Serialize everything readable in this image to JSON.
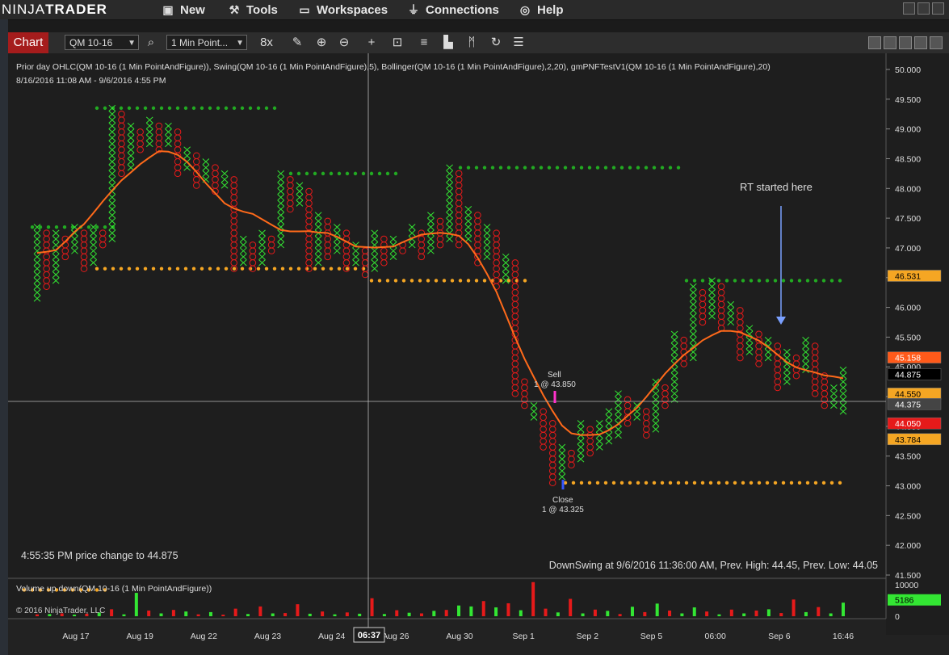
{
  "app": {
    "logo_light": "NINJA",
    "logo_bold": "TRADER",
    "menu": [
      {
        "label": "New",
        "icon": "new-icon"
      },
      {
        "label": "Tools",
        "icon": "tools-icon"
      },
      {
        "label": "Workspaces",
        "icon": "workspaces-icon"
      },
      {
        "label": "Connections",
        "icon": "connections-icon"
      },
      {
        "label": "Help",
        "icon": "help-icon"
      }
    ]
  },
  "toolbar": {
    "tab_label": "Chart",
    "instrument": "QM 10-16",
    "interval": "1 Min Point...",
    "tools": [
      "search-icon",
      "bar-type-icon",
      "draw-icon",
      "zoom-in-icon",
      "zoom-out-icon",
      "crosshair-icon",
      "data-box-icon",
      "indicators-icon",
      "strategies-icon",
      "properties-icon",
      "reload-icon",
      "list-icon"
    ]
  },
  "chart": {
    "header_line1": "Prior day OHLC(QM 10-16 (1 Min PointAndFigure)), Swing(QM 10-16 (1 Min PointAndFigure),5), Bollinger(QM 10-16 (1 Min PointAndFigure),2,20), gmPNFTestV1(QM 10-16 (1 Min PointAndFigure),20)",
    "header_line2": "8/16/2016 11:08 AM - 9/6/2016 4:55 PM",
    "annotation_rt": "RT started here",
    "sell_label": "Sell",
    "sell_detail": "1 @ 43.850",
    "close_label": "Close",
    "close_detail": "1 @ 43.325",
    "status_left": "4:55:35 PM price change to 44.875",
    "status_right": "DownSwing at 9/6/2016 11:36:00 AM, Prev. High: 44.45, Prev. Low: 44.05",
    "volume_header": "Volume up down(QM 10-16 (1 Min PointAndFigure))",
    "copyright": "© 2016 NinjaTrader, LLC",
    "crosshair_time": "06:37",
    "colors": {
      "up": "#33e633",
      "down": "#e61a1a",
      "bollinger": "#f0a030",
      "swing": "#ff6a1a"
    }
  },
  "chart_data": {
    "type": "point-and-figure",
    "y_axis": {
      "min": 41.5,
      "max": 50.0,
      "ticks": [
        "50.000",
        "49.500",
        "49.000",
        "48.500",
        "48.000",
        "47.500",
        "47.000",
        "46.500",
        "46.000",
        "45.500",
        "45.000",
        "44.500",
        "44.000",
        "43.500",
        "43.000",
        "42.500",
        "42.000",
        "41.500"
      ]
    },
    "x_axis": {
      "labels": [
        "Aug 17",
        "Aug 19",
        "Aug 22",
        "Aug 23",
        "Aug 24",
        "Aug 26",
        "Aug 30",
        "Sep 1",
        "Sep 2",
        "Sep 5",
        "06:00",
        "Sep 6",
        "16:46"
      ]
    },
    "price_markers": [
      {
        "label": "46.531",
        "value": 46.531,
        "color": "#f5a623",
        "text_color": "#000"
      },
      {
        "label": "45.158",
        "value": 45.158,
        "color": "#ff5a1a",
        "text_color": "#fff"
      },
      {
        "label": "44.875",
        "value": 44.875,
        "color": "#000000",
        "text_color": "#fff"
      },
      {
        "label": "44.550",
        "value": 44.55,
        "color": "#f5a623",
        "text_color": "#000"
      },
      {
        "label": "44.375",
        "value": 44.375,
        "color": "#444444",
        "text_color": "#fff"
      },
      {
        "label": "44.050",
        "value": 44.05,
        "color": "#e61a1a",
        "text_color": "#fff"
      },
      {
        "label": "43.784",
        "value": 43.784,
        "color": "#f5a623",
        "text_color": "#000"
      }
    ],
    "columns": [
      {
        "t": "X",
        "lo": 46.15,
        "hi": 47.35
      },
      {
        "t": "O",
        "lo": 46.35,
        "hi": 47.25
      },
      {
        "t": "X",
        "lo": 46.45,
        "hi": 47.25
      },
      {
        "t": "O",
        "lo": 46.85,
        "hi": 47.15
      },
      {
        "t": "X",
        "lo": 46.95,
        "hi": 47.35
      },
      {
        "t": "O",
        "lo": 46.65,
        "hi": 47.25
      },
      {
        "t": "X",
        "lo": 46.75,
        "hi": 47.35
      },
      {
        "t": "O",
        "lo": 47.05,
        "hi": 47.25
      },
      {
        "t": "X",
        "lo": 47.15,
        "hi": 49.35
      },
      {
        "t": "O",
        "lo": 48.25,
        "hi": 49.25
      },
      {
        "t": "X",
        "lo": 48.35,
        "hi": 49.05
      },
      {
        "t": "O",
        "lo": 48.65,
        "hi": 48.95
      },
      {
        "t": "X",
        "lo": 48.75,
        "hi": 49.15
      },
      {
        "t": "O",
        "lo": 48.65,
        "hi": 49.05
      },
      {
        "t": "X",
        "lo": 48.75,
        "hi": 49.05
      },
      {
        "t": "O",
        "lo": 48.25,
        "hi": 48.95
      },
      {
        "t": "X",
        "lo": 48.35,
        "hi": 48.65
      },
      {
        "t": "O",
        "lo": 48.05,
        "hi": 48.55
      },
      {
        "t": "X",
        "lo": 48.15,
        "hi": 48.45
      },
      {
        "t": "O",
        "lo": 47.95,
        "hi": 48.35
      },
      {
        "t": "X",
        "lo": 48.05,
        "hi": 48.25
      },
      {
        "t": "O",
        "lo": 46.65,
        "hi": 48.15
      },
      {
        "t": "X",
        "lo": 46.75,
        "hi": 47.15
      },
      {
        "t": "O",
        "lo": 46.65,
        "hi": 47.05
      },
      {
        "t": "X",
        "lo": 46.75,
        "hi": 47.25
      },
      {
        "t": "O",
        "lo": 46.95,
        "hi": 47.15
      },
      {
        "t": "X",
        "lo": 47.05,
        "hi": 48.25
      },
      {
        "t": "O",
        "lo": 47.65,
        "hi": 48.15
      },
      {
        "t": "X",
        "lo": 47.75,
        "hi": 48.05
      },
      {
        "t": "O",
        "lo": 46.65,
        "hi": 47.95
      },
      {
        "t": "X",
        "lo": 46.75,
        "hi": 47.55
      },
      {
        "t": "O",
        "lo": 46.85,
        "hi": 47.45
      },
      {
        "t": "X",
        "lo": 46.95,
        "hi": 47.35
      },
      {
        "t": "O",
        "lo": 46.65,
        "hi": 47.25
      },
      {
        "t": "X",
        "lo": 46.75,
        "hi": 47.05
      },
      {
        "t": "O",
        "lo": 46.55,
        "hi": 46.95
      },
      {
        "t": "X",
        "lo": 46.65,
        "hi": 47.25
      },
      {
        "t": "O",
        "lo": 46.75,
        "hi": 47.15
      },
      {
        "t": "X",
        "lo": 46.85,
        "hi": 47.15
      },
      {
        "t": "O",
        "lo": 46.95,
        "hi": 47.05
      },
      {
        "t": "X",
        "lo": 47.05,
        "hi": 47.35
      },
      {
        "t": "O",
        "lo": 46.85,
        "hi": 47.25
      },
      {
        "t": "X",
        "lo": 46.95,
        "hi": 47.55
      },
      {
        "t": "O",
        "lo": 47.05,
        "hi": 47.45
      },
      {
        "t": "X",
        "lo": 47.15,
        "hi": 48.35
      },
      {
        "t": "O",
        "lo": 47.05,
        "hi": 48.25
      },
      {
        "t": "X",
        "lo": 47.15,
        "hi": 47.65
      },
      {
        "t": "O",
        "lo": 46.75,
        "hi": 47.55
      },
      {
        "t": "X",
        "lo": 46.85,
        "hi": 47.35
      },
      {
        "t": "O",
        "lo": 46.35,
        "hi": 47.25
      },
      {
        "t": "X",
        "lo": 46.45,
        "hi": 46.85
      },
      {
        "t": "O",
        "lo": 44.55,
        "hi": 46.75
      },
      {
        "t": "O",
        "lo": 44.35,
        "hi": 44.75
      },
      {
        "t": "X",
        "lo": 44.15,
        "hi": 44.35
      },
      {
        "t": "O",
        "lo": 43.65,
        "hi": 44.25
      },
      {
        "t": "O",
        "lo": 43.05,
        "hi": 44.05
      },
      {
        "t": "X",
        "lo": 43.15,
        "hi": 43.65
      },
      {
        "t": "O",
        "lo": 43.35,
        "hi": 43.55
      },
      {
        "t": "X",
        "lo": 43.45,
        "hi": 44.05
      },
      {
        "t": "O",
        "lo": 43.55,
        "hi": 43.95
      },
      {
        "t": "X",
        "lo": 43.65,
        "hi": 44.05
      },
      {
        "t": "X",
        "lo": 43.75,
        "hi": 44.25
      },
      {
        "t": "X",
        "lo": 43.85,
        "hi": 44.55
      },
      {
        "t": "O",
        "lo": 44.05,
        "hi": 44.45
      },
      {
        "t": "X",
        "lo": 44.15,
        "hi": 44.35
      },
      {
        "t": "O",
        "lo": 43.85,
        "hi": 44.25
      },
      {
        "t": "X",
        "lo": 43.95,
        "hi": 44.75
      },
      {
        "t": "O",
        "lo": 44.35,
        "hi": 44.65
      },
      {
        "t": "X",
        "lo": 44.45,
        "hi": 45.55
      },
      {
        "t": "O",
        "lo": 45.05,
        "hi": 45.45
      },
      {
        "t": "X",
        "lo": 45.15,
        "hi": 46.35
      },
      {
        "t": "O",
        "lo": 45.75,
        "hi": 46.25
      },
      {
        "t": "X",
        "lo": 45.85,
        "hi": 46.45
      },
      {
        "t": "O",
        "lo": 45.65,
        "hi": 46.35
      },
      {
        "t": "X",
        "lo": 45.75,
        "hi": 46.05
      },
      {
        "t": "O",
        "lo": 45.15,
        "hi": 45.95
      },
      {
        "t": "X",
        "lo": 45.25,
        "hi": 45.65
      },
      {
        "t": "O",
        "lo": 45.05,
        "hi": 45.55
      },
      {
        "t": "X",
        "lo": 45.15,
        "hi": 45.45
      },
      {
        "t": "O",
        "lo": 44.65,
        "hi": 45.35
      },
      {
        "t": "X",
        "lo": 44.75,
        "hi": 45.25
      },
      {
        "t": "O",
        "lo": 44.85,
        "hi": 45.15
      },
      {
        "t": "X",
        "lo": 44.95,
        "hi": 45.45
      },
      {
        "t": "O",
        "lo": 44.55,
        "hi": 45.35
      },
      {
        "t": "O",
        "lo": 44.35,
        "hi": 44.85
      },
      {
        "t": "X",
        "lo": 44.35,
        "hi": 44.65
      },
      {
        "t": "X",
        "lo": 44.25,
        "hi": 44.95
      }
    ],
    "volume": [
      {
        "v": 600,
        "up": false
      },
      {
        "v": 700,
        "up": true
      },
      {
        "v": 900,
        "up": false
      },
      {
        "v": 500,
        "up": true
      },
      {
        "v": 800,
        "up": false
      },
      {
        "v": 1200,
        "up": true
      },
      {
        "v": 2200,
        "up": false
      },
      {
        "v": 600,
        "up": true
      },
      {
        "v": 7400,
        "up": true
      },
      {
        "v": 1800,
        "up": false
      },
      {
        "v": 900,
        "up": true
      },
      {
        "v": 2000,
        "up": false
      },
      {
        "v": 1500,
        "up": true
      },
      {
        "v": 600,
        "up": false
      },
      {
        "v": 1300,
        "up": true
      },
      {
        "v": 500,
        "up": false
      },
      {
        "v": 2400,
        "up": false
      },
      {
        "v": 700,
        "up": true
      },
      {
        "v": 3100,
        "up": false
      },
      {
        "v": 900,
        "up": true
      },
      {
        "v": 1000,
        "up": false
      },
      {
        "v": 3800,
        "up": false
      },
      {
        "v": 800,
        "up": true
      },
      {
        "v": 1500,
        "up": false
      },
      {
        "v": 600,
        "up": true
      },
      {
        "v": 1200,
        "up": false
      },
      {
        "v": 800,
        "up": true
      },
      {
        "v": 5700,
        "up": false
      },
      {
        "v": 700,
        "up": true
      },
      {
        "v": 1900,
        "up": false
      },
      {
        "v": 1100,
        "up": true
      },
      {
        "v": 900,
        "up": false
      },
      {
        "v": 1700,
        "up": true
      },
      {
        "v": 2000,
        "up": false
      },
      {
        "v": 3400,
        "up": true
      },
      {
        "v": 3100,
        "up": true
      },
      {
        "v": 4800,
        "up": false
      },
      {
        "v": 2800,
        "up": true
      },
      {
        "v": 4100,
        "up": false
      },
      {
        "v": 1900,
        "up": true
      },
      {
        "v": 10800,
        "up": false
      },
      {
        "v": 2400,
        "up": false
      },
      {
        "v": 1200,
        "up": true
      },
      {
        "v": 5500,
        "up": false
      },
      {
        "v": 900,
        "up": true
      },
      {
        "v": 2100,
        "up": false
      },
      {
        "v": 1700,
        "up": true
      },
      {
        "v": 700,
        "up": false
      },
      {
        "v": 3000,
        "up": true
      },
      {
        "v": 1300,
        "up": false
      },
      {
        "v": 4000,
        "up": true
      },
      {
        "v": 1800,
        "up": false
      },
      {
        "v": 900,
        "up": true
      },
      {
        "v": 2800,
        "up": true
      },
      {
        "v": 1500,
        "up": false
      },
      {
        "v": 600,
        "up": true
      },
      {
        "v": 2100,
        "up": false
      },
      {
        "v": 900,
        "up": true
      },
      {
        "v": 1800,
        "up": false
      },
      {
        "v": 2200,
        "up": true
      },
      {
        "v": 1000,
        "up": false
      },
      {
        "v": 5300,
        "up": false
      },
      {
        "v": 1300,
        "up": true
      },
      {
        "v": 2900,
        "up": false
      },
      {
        "v": 900,
        "up": true
      },
      {
        "v": 4300,
        "up": true
      }
    ],
    "volume_axis": {
      "ticks": [
        "10000",
        "5000",
        "0"
      ],
      "max": 11000,
      "marker": "5186"
    }
  }
}
